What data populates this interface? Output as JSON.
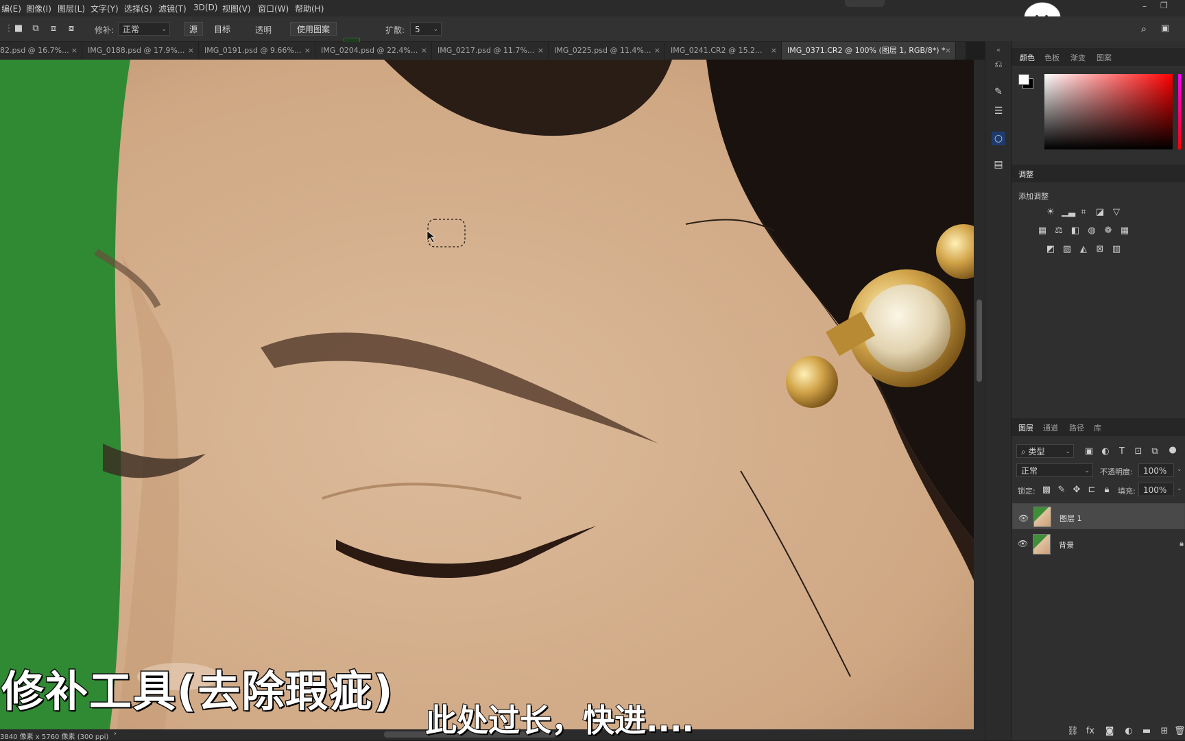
{
  "menu": {
    "items": [
      "编(E)",
      "图像(I)",
      "图层(L)",
      "文字(Y)",
      "选择(S)",
      "滤镜(T)",
      "3D(D)",
      "视图(V)",
      "窗口(W)",
      "帮助(H)"
    ]
  },
  "options": {
    "patch_label": "修补:",
    "patch_mode": "正常",
    "source_label": "源",
    "target_label": "目标",
    "transparent_label": "透明",
    "use_pattern_label": "使用图案",
    "diffusion_label": "扩散:",
    "diffusion_value": "5"
  },
  "tabs": [
    {
      "label": "82.psd @ 16.7%...",
      "close": "×"
    },
    {
      "label": "IMG_0188.psd @ 17.9%...",
      "close": "×"
    },
    {
      "label": "IMG_0191.psd @ 9.66%...",
      "close": "×"
    },
    {
      "label": "IMG_0204.psd @ 22.4%...",
      "close": "×"
    },
    {
      "label": "IMG_0217.psd @ 11.7%...",
      "close": "×"
    },
    {
      "label": "IMG_0225.psd @ 11.4%...",
      "close": "×"
    },
    {
      "label": "IMG_0241.CR2 @ 15.2...",
      "close": "×"
    },
    {
      "label": "IMG_0371.CR2 @ 100% (图层 1, RGB/8*) *",
      "close": "×"
    }
  ],
  "status": {
    "doc_info": "3840 像素 x 5760 像素 (300 ppi)",
    "arrow": "›"
  },
  "color_panel": {
    "tabs": [
      "颜色",
      "色板",
      "渐变",
      "图案"
    ]
  },
  "adjustments_panel": {
    "tab": "调整",
    "add_label": "添加调整"
  },
  "layers_panel": {
    "tabs": [
      "图层",
      "通道",
      "路径",
      "库"
    ],
    "filter_kind": "类型",
    "blend_mode": "正常",
    "opacity_label": "不透明度:",
    "opacity_value": "100%",
    "lock_label": "锁定:",
    "fill_label": "填充:",
    "fill_value": "100%",
    "layers": [
      {
        "name": "图层 1",
        "selected": true
      },
      {
        "name": "背景",
        "selected": false
      }
    ]
  },
  "subtitles": {
    "title": "修补工具(去除瑕疵)",
    "caption": "此处过长，快进...."
  },
  "colors": {
    "green_screen": "#2f8a33",
    "skin": "#d6b08f",
    "hair": "#1a120e",
    "accent_selection": "#5a5a5a"
  }
}
